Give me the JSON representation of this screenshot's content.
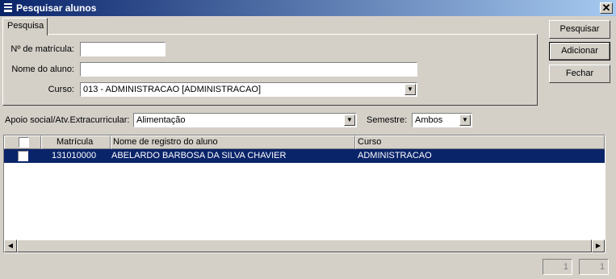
{
  "window": {
    "title": "Pesquisar alunos",
    "close_glyph": "✕",
    "icon": "window-menu-icon"
  },
  "tabs": [
    {
      "label": "Pesquisa"
    }
  ],
  "form": {
    "matricula_label": "Nº de matrícula:",
    "matricula_value": "",
    "nome_label": "Nome do aluno:",
    "nome_value": "",
    "curso_label": "Curso:",
    "curso_value": "013 - ADMINISTRACAO [ADMINISTRACAO]"
  },
  "buttons": {
    "pesquisar": "Pesquisar",
    "adicionar": "Adicionar",
    "fechar": "Fechar"
  },
  "filters": {
    "apoio_label": "Apoio social/Atv.Extracurricular:",
    "apoio_value": "Alimentação",
    "semestre_label": "Semestre:",
    "semestre_value": "Ambos"
  },
  "grid": {
    "columns": [
      "Matrícula",
      "Nome de registro do aluno",
      "Curso"
    ],
    "rows": [
      {
        "matricula": "131010000",
        "nome": "ABELARDO BARBOSA DA SILVA CHAVIER",
        "curso": "ADMINISTRACAO",
        "selected": true
      }
    ]
  },
  "status": {
    "counter_left": "1",
    "counter_right": "1"
  },
  "colors": {
    "title_start": "#0a246a",
    "title_end": "#a6caf0",
    "selection": "#0a246a",
    "face": "#d4d0c8"
  }
}
